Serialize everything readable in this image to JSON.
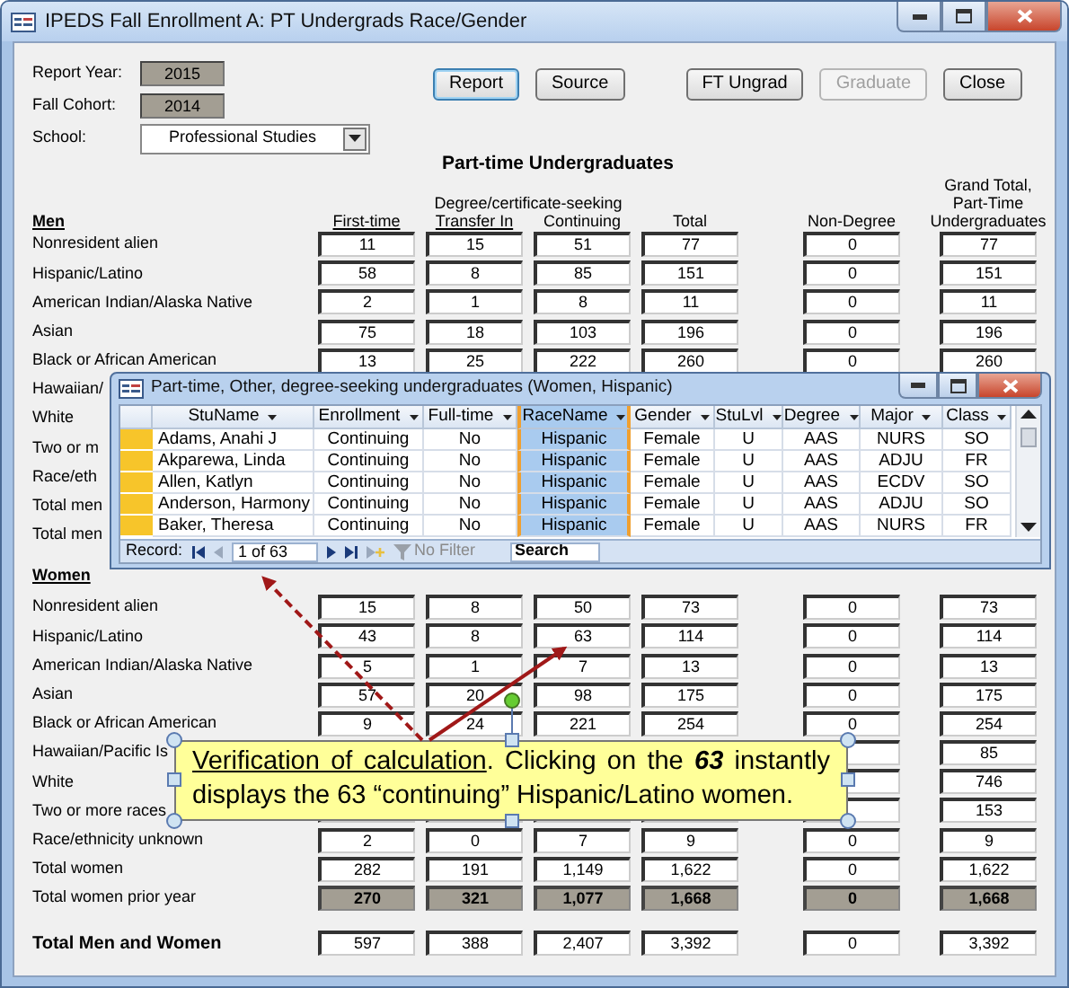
{
  "window": {
    "title": "IPEDS Fall Enrollment A: PT Undergrads Race/Gender"
  },
  "fields": [
    {
      "label": "Report Year:",
      "value": "2015",
      "kind": "locked"
    },
    {
      "label": "Fall Cohort:",
      "value": "2014",
      "kind": "locked"
    },
    {
      "label": "School:",
      "value": "Professional Studies",
      "kind": "dropdown"
    }
  ],
  "buttons": [
    {
      "label": "Report",
      "disabled": false,
      "focused": true
    },
    {
      "label": "Source",
      "disabled": false,
      "focused": false
    },
    {
      "label": "FT Ungrad",
      "disabled": false,
      "focused": false
    },
    {
      "label": "Graduate",
      "disabled": true,
      "focused": false
    },
    {
      "label": "Close",
      "disabled": false,
      "focused": false
    }
  ],
  "section_title": "Part-time Undergraduates",
  "column_group": "Degree/certificate-seeking",
  "columns": [
    {
      "label": "First-time",
      "underlined": true
    },
    {
      "label": "Transfer In",
      "underlined": true
    },
    {
      "label": "Continuing",
      "underlined": false
    },
    {
      "label": "Total",
      "underlined": false
    },
    {
      "label": "Non-Degree",
      "underlined": false
    },
    {
      "label": "Grand Total, Part-Time Undergraduates",
      "underlined": false
    }
  ],
  "men": {
    "heading": "Men",
    "rows": [
      {
        "label": "Nonresident alien",
        "kind": "count",
        "values": [
          "11",
          "15",
          "51",
          "77",
          "0",
          "77"
        ]
      },
      {
        "label": "Hispanic/Latino",
        "kind": "count",
        "values": [
          "58",
          "8",
          "85",
          "151",
          "0",
          "151"
        ]
      },
      {
        "label": "American Indian/Alaska Native",
        "kind": "count",
        "values": [
          "2",
          "1",
          "8",
          "11",
          "0",
          "11"
        ]
      },
      {
        "label": "Asian",
        "kind": "count",
        "values": [
          "75",
          "18",
          "103",
          "196",
          "0",
          "196"
        ]
      },
      {
        "label": "Black or African American",
        "kind": "count",
        "values": [
          "13",
          "25",
          "222",
          "260",
          "0",
          "260"
        ]
      },
      {
        "label": "Hawaiian/"
      },
      {
        "label": "White"
      },
      {
        "label": "Two or m"
      },
      {
        "label": "Race/eth"
      },
      {
        "label": "Total men"
      },
      {
        "label": "Total men"
      }
    ]
  },
  "women": {
    "heading": "Women",
    "rows": [
      {
        "label": "Nonresident alien",
        "kind": "count",
        "values": [
          "15",
          "8",
          "50",
          "73",
          "0",
          "73"
        ]
      },
      {
        "label": "Hispanic/Latino",
        "kind": "count",
        "values": [
          "43",
          "8",
          "63",
          "114",
          "0",
          "114"
        ]
      },
      {
        "label": "American Indian/Alaska Native",
        "kind": "count",
        "values": [
          "5",
          "1",
          "7",
          "13",
          "0",
          "13"
        ]
      },
      {
        "label": "Asian",
        "kind": "count",
        "values": [
          "57",
          "20",
          "98",
          "175",
          "0",
          "175"
        ]
      },
      {
        "label": "Black or African American",
        "kind": "count",
        "values": [
          "9",
          "24",
          "221",
          "254",
          "0",
          "254"
        ]
      },
      {
        "label": "Hawaiian/Pacific Is",
        "kind": "count",
        "grand_total": "85"
      },
      {
        "label": "White",
        "kind": "count",
        "grand_total": "746"
      },
      {
        "label": "Two or more races",
        "kind": "count",
        "grand_total": "153"
      },
      {
        "label": "Race/ethnicity unknown",
        "kind": "count",
        "values": [
          "2",
          "0",
          "7",
          "9",
          "0",
          "9"
        ]
      },
      {
        "label": "Total women",
        "kind": "count",
        "values": [
          "282",
          "191",
          "1,149",
          "1,622",
          "0",
          "1,622"
        ]
      },
      {
        "label": "Total women prior year",
        "kind": "prior",
        "values": [
          "270",
          "321",
          "1,077",
          "1,668",
          "0",
          "1,668"
        ]
      }
    ]
  },
  "grand_total": {
    "label": "Total Men and Women",
    "values": [
      "597",
      "388",
      "2,407",
      "3,392",
      "0",
      "3,392"
    ]
  },
  "popup": {
    "title": "Part-time, Other, degree-seeking undergraduates (Women, Hispanic)",
    "columns": [
      {
        "label": "StuName",
        "selected": false
      },
      {
        "label": "Enrollment",
        "selected": false
      },
      {
        "label": "Full-time",
        "selected": false
      },
      {
        "label": "RaceName",
        "selected": true
      },
      {
        "label": "Gender",
        "selected": false
      },
      {
        "label": "StuLvl",
        "selected": false
      },
      {
        "label": "Degree",
        "selected": false
      },
      {
        "label": "Major",
        "selected": false
      },
      {
        "label": "Class",
        "selected": false
      }
    ],
    "rows": [
      [
        "Adams, Anahi J",
        "Continuing",
        "No",
        "Hispanic",
        "Female",
        "U",
        "AAS",
        "NURS",
        "SO"
      ],
      [
        "Akparewa, Linda",
        "Continuing",
        "No",
        "Hispanic",
        "Female",
        "U",
        "AAS",
        "ADJU",
        "FR"
      ],
      [
        "Allen, Katlyn",
        "Continuing",
        "No",
        "Hispanic",
        "Female",
        "U",
        "AAS",
        "ECDV",
        "SO"
      ],
      [
        "Anderson, Harmony",
        "Continuing",
        "No",
        "Hispanic",
        "Female",
        "U",
        "AAS",
        "ADJU",
        "SO"
      ],
      [
        "Baker, Theresa",
        "Continuing",
        "No",
        "Hispanic",
        "Female",
        "U",
        "AAS",
        "NURS",
        "FR"
      ]
    ],
    "record_label": "Record:",
    "record_position": "1 of 63",
    "filter": "No Filter",
    "search_placeholder": "Search"
  },
  "callout": {
    "link": "Verification of calculation",
    "text": ".  Clicking on the **63** instantly displays the 63 “continuing” Hispanic/Latino women."
  }
}
